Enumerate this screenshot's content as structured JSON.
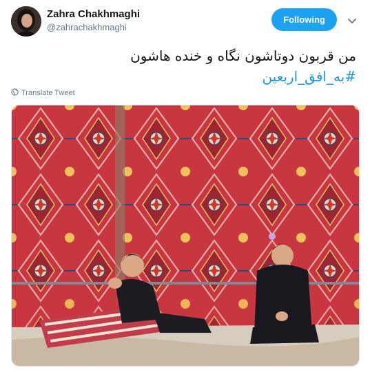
{
  "author": {
    "name": "Zahra Chakhmaghi",
    "handle": "@zahrachakhmaghi",
    "avatar_icon": "avatar-photo"
  },
  "actions": {
    "follow_label": "Following",
    "caret_icon": "chevron-down-icon"
  },
  "tweet": {
    "text_line1": "من قربون دوتاشون نگاه و خنده هاشون",
    "hashtag": "#به_افق_اربعین",
    "translate_label": "Translate Tweet",
    "translate_icon": "globe-icon"
  },
  "media": {
    "kind": "photo"
  },
  "colors": {
    "accent": "#1da1f2",
    "hashtag": "#1b95e0",
    "muted": "#657786"
  }
}
